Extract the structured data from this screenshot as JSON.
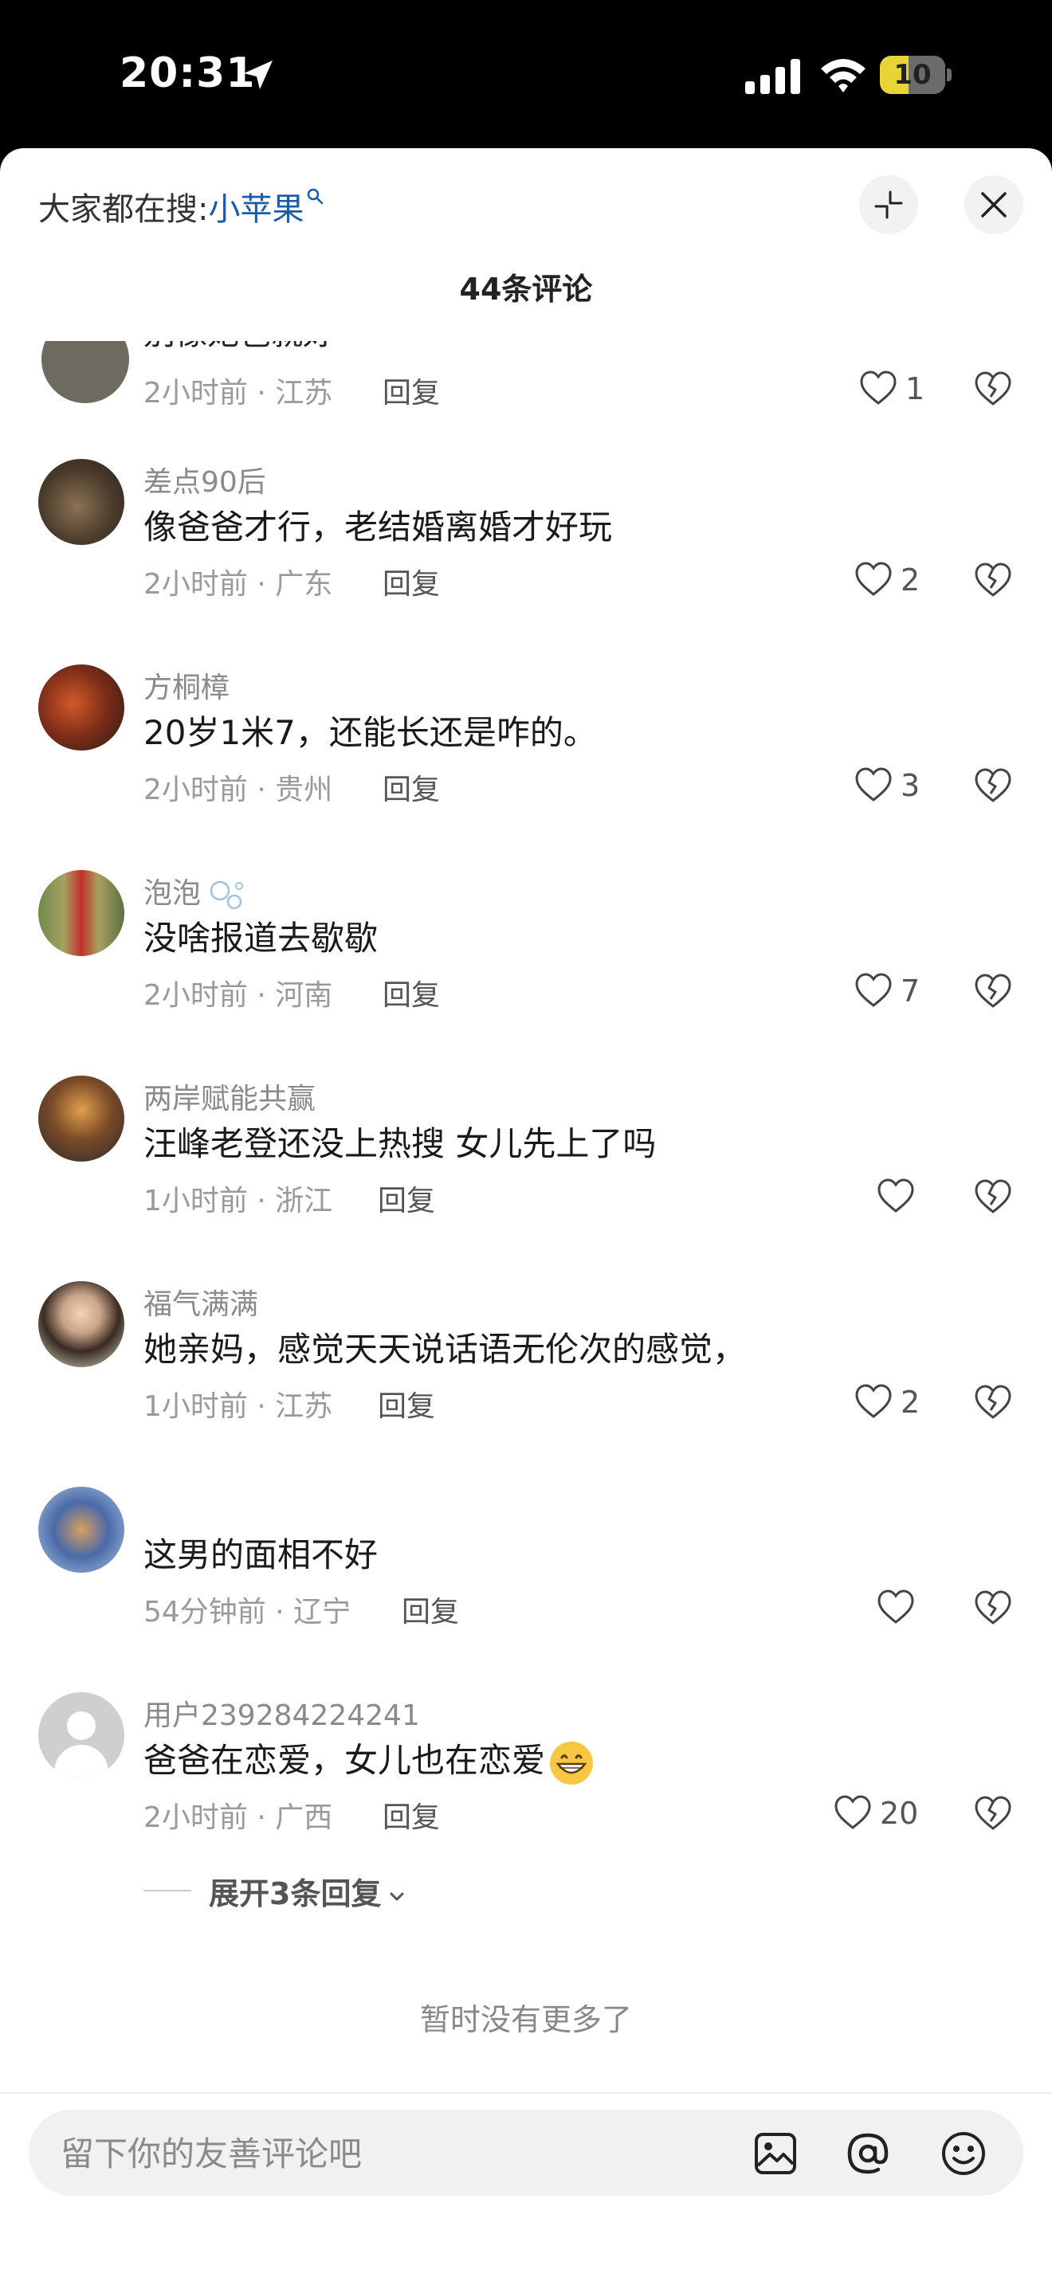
{
  "status_bar": {
    "time": "20:31",
    "battery": "10"
  },
  "header": {
    "search_prefix": "大家都在搜:",
    "search_keyword": "小苹果",
    "comment_count_title": "44条评论"
  },
  "partial_comment": {
    "content": "别像她爸就好",
    "meta": "2小时前 · 江苏",
    "reply": "回复",
    "likes": "1"
  },
  "comments": [
    {
      "username": "差点90后",
      "content": "像爸爸才行，老结婚离婚才好玩",
      "meta": "2小时前 · 广东",
      "reply": "回复",
      "likes": "2"
    },
    {
      "username": "方桐樟",
      "content": "20岁1米7，还能长还是咋的。",
      "meta": "2小时前 · 贵州",
      "reply": "回复",
      "likes": "3"
    },
    {
      "username": "泡泡",
      "content": "没啥报道去歇歇",
      "meta": "2小时前 · 河南",
      "reply": "回复",
      "likes": "7"
    },
    {
      "username": "两岸赋能共赢",
      "content": "汪峰老登还没上热搜 女儿先上了吗",
      "meta": "1小时前 · 浙江",
      "reply": "回复",
      "likes": ""
    },
    {
      "username": "福气满满",
      "content": "她亲妈，感觉天天说话语无伦次的感觉，",
      "meta": "1小时前 · 江苏",
      "reply": "回复",
      "likes": "2"
    },
    {
      "username": "",
      "content": "这男的面相不好",
      "meta": "54分钟前 · 辽宁",
      "reply": "回复",
      "likes": ""
    },
    {
      "username": "用户239284224241",
      "content": "爸爸在恋爱，女儿也在恋爱",
      "meta": "2小时前 · 广西",
      "reply": "回复",
      "likes": "20"
    }
  ],
  "expand_replies": "展开3条回复",
  "no_more": "暂时没有更多了",
  "input": {
    "placeholder": "留下你的友善评论吧"
  },
  "icons": [
    "location-arrow-icon",
    "signal-icon",
    "wifi-icon",
    "battery-icon",
    "search-icon",
    "collapse-icon",
    "close-icon",
    "heart-icon",
    "broken-heart-icon",
    "chevron-down-icon",
    "image-icon",
    "at-icon",
    "emoji-icon"
  ],
  "colors": {
    "keyword": "#1d5aa8",
    "battery": "#e8d437"
  }
}
